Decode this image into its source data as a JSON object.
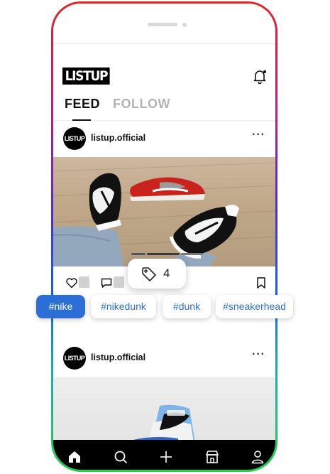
{
  "app": {
    "logo_text": "LISTUP"
  },
  "tabs": [
    {
      "label": "FEED",
      "active": true
    },
    {
      "label": "FOLLOW",
      "active": false
    }
  ],
  "posts": [
    {
      "avatar_text": "LISTUP",
      "username": "listup.official",
      "more": "···",
      "image_icon": "sneakers-photo",
      "carousel": {
        "pages": 3,
        "current": 2
      }
    },
    {
      "avatar_text": "LISTUP",
      "username": "listup.official",
      "more": "···",
      "image_icon": "sneaker-photo"
    }
  ],
  "tag_popup": {
    "icon": "tag-icon",
    "count": "4"
  },
  "hashtags": [
    {
      "label": "#nike",
      "active": true
    },
    {
      "label": "#nikedunk",
      "active": false
    },
    {
      "label": "#dunk",
      "active": false
    },
    {
      "label": "#sneakerhead",
      "active": false
    }
  ],
  "bottom_nav": [
    {
      "name": "home-icon"
    },
    {
      "name": "search-icon"
    },
    {
      "name": "add-icon"
    },
    {
      "name": "store-icon"
    },
    {
      "name": "profile-icon"
    }
  ],
  "colors": {
    "accent": "#2b6fd6",
    "frame_top": "#e12424",
    "frame_bottom": "#22d14a"
  }
}
